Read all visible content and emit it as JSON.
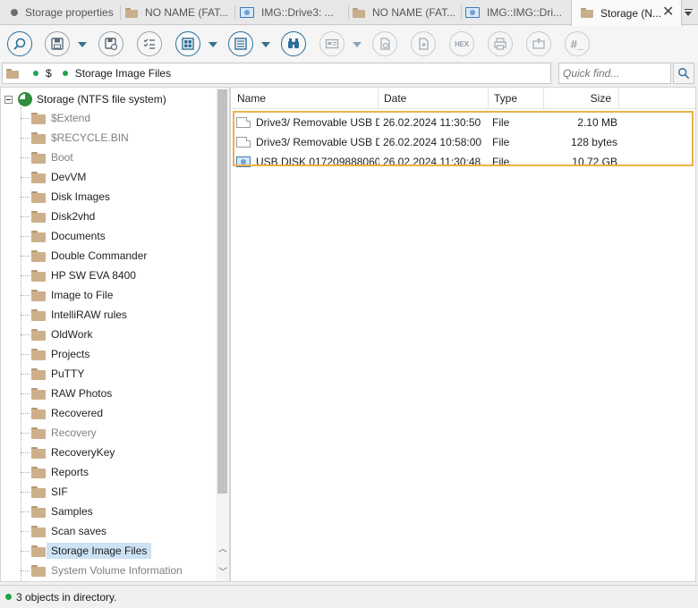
{
  "tabs": [
    {
      "label": "Storage properties",
      "icon": "dot-icon",
      "active": false
    },
    {
      "label": "NO NAME (FAT...",
      "icon": "folder-icon",
      "active": false
    },
    {
      "label": "IMG::Drive3: ...",
      "icon": "disk-image-icon",
      "active": false
    },
    {
      "label": "NO NAME (FAT...",
      "icon": "folder-icon",
      "active": false
    },
    {
      "label": "IMG::IMG::Dri...",
      "icon": "disk-image-icon",
      "active": false
    },
    {
      "label": "Storage (N...",
      "icon": "folder-icon",
      "active": true
    }
  ],
  "toolbar": {
    "hex_label": "HEX",
    "hash_label": "#_",
    "buttons": [
      "zoom-icon",
      "save-icon",
      "save-settings-icon",
      "checklist-icon",
      "view-mode-icon",
      "list-view-icon",
      "find-icon",
      "preview-icon",
      "recover-icon",
      "export-icon",
      "hex-icon",
      "print-icon",
      "go-to-icon",
      "hash-icon"
    ]
  },
  "address": {
    "root_label": "$",
    "path_label": "Storage Image Files"
  },
  "search": {
    "placeholder": "Quick find..."
  },
  "tree": {
    "root_label": "Storage (NTFS file system)",
    "items": [
      {
        "label": "$Extend",
        "style": "gray"
      },
      {
        "label": "$RECYCLE.BIN",
        "style": "gray"
      },
      {
        "label": "Boot",
        "style": "gray"
      },
      {
        "label": "DevVM",
        "style": "normal"
      },
      {
        "label": "Disk Images",
        "style": "normal"
      },
      {
        "label": "Disk2vhd",
        "style": "normal"
      },
      {
        "label": "Documents",
        "style": "normal"
      },
      {
        "label": "Double Commander",
        "style": "normal"
      },
      {
        "label": "HP SW EVA 8400",
        "style": "normal"
      },
      {
        "label": "Image to File",
        "style": "normal"
      },
      {
        "label": "IntelliRAW rules",
        "style": "normal"
      },
      {
        "label": "OldWork",
        "style": "normal"
      },
      {
        "label": "Projects",
        "style": "normal"
      },
      {
        "label": "PuTTY",
        "style": "normal"
      },
      {
        "label": "RAW Photos",
        "style": "normal"
      },
      {
        "label": "Recovered",
        "style": "normal"
      },
      {
        "label": "Recovery",
        "style": "gray"
      },
      {
        "label": "RecoveryKey",
        "style": "normal"
      },
      {
        "label": "Reports",
        "style": "normal"
      },
      {
        "label": "SIF",
        "style": "normal"
      },
      {
        "label": "Samples",
        "style": "normal"
      },
      {
        "label": "Scan saves",
        "style": "normal"
      },
      {
        "label": "Storage Image Files",
        "style": "selected"
      },
      {
        "label": "System Volume Information",
        "style": "gray"
      }
    ]
  },
  "files": {
    "columns": {
      "name": "Name",
      "date": "Date",
      "type": "Type",
      "size": "Size"
    },
    "rows": [
      {
        "name": "Drive3/ Removable USB D...",
        "date": "26.02.2024 11:30:50",
        "type": "File",
        "size": "2.10 MB",
        "icon": "file-icon"
      },
      {
        "name": "Drive3/ Removable USB D...",
        "date": "26.02.2024 10:58:00",
        "type": "File",
        "size": "128 bytes",
        "icon": "file-icon"
      },
      {
        "name": "USB DISK 017209888060...",
        "date": "26.02.2024 11:30:48",
        "type": "File",
        "size": "10.72 GB",
        "icon": "disk-image-icon"
      }
    ]
  },
  "status": {
    "text": "3 objects in directory."
  },
  "colors": {
    "highlight": "#e8b24a",
    "status_dot": "#1aa648",
    "accent": "#2a6e9a"
  }
}
